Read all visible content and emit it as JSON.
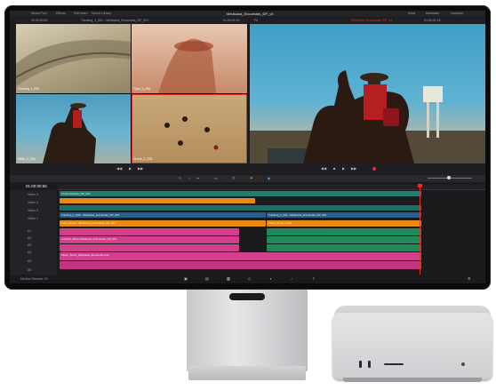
{
  "app": {
    "project_title": "Medicana_Encuestas_DP_v4",
    "top_menu": [
      "Media Pool",
      "Effects",
      "Edit Index",
      "Sound Library"
    ],
    "top_right_menu": [
      "Mixer",
      "Metadata",
      "Inspector"
    ],
    "viewer_left_header": "Tracking_1_001 - Medicana_Encuestas_DP_001",
    "viewer_left_timecode": "00:00:00:00",
    "viewer_right_zoom": "Fit",
    "viewer_right_timecode": "01:00:01:00",
    "viewer_right_header": "Medicana_Encuestas_DP_v4",
    "viewer_right_tc_end": "01:00:01:15"
  },
  "multicam": {
    "angles": [
      {
        "label": "Tracking 1_005"
      },
      {
        "label": "Tight_1_008"
      },
      {
        "label": "Wide_1_006"
      },
      {
        "label": "Drone_1_008"
      }
    ]
  },
  "timeline": {
    "timecode": "01:00:00:58",
    "tracks": [
      {
        "name": "Video 4"
      },
      {
        "name": "Video 3"
      },
      {
        "name": "Video 2"
      },
      {
        "name": "Video 1"
      },
      {
        "name": "A1"
      },
      {
        "name": "A2"
      },
      {
        "name": "A3"
      },
      {
        "name": "A4"
      },
      {
        "name": "A5"
      },
      {
        "name": "A6"
      }
    ],
    "clip_labels": {
      "v4": "Cross Dissolve_DP_001",
      "v1a": "Tracking_1_005 - Medicana_Encuestas_DP_001",
      "v1b": "Tracking_1_001 - Medicana_Encuestas_DP_001",
      "a1a": "Foley_Horse - Medicana_Encuestas_DP_001",
      "a1b": "Foley_Horse_2.wav",
      "a3": "Ambient_Wind_Medicana_Encuestas_DP_001",
      "a5": "Music_Score_Medicana_Encuestas.wav"
    },
    "footer_status": "DaVinci Resolve 19"
  },
  "colors": {
    "accent_red": "#e0322b",
    "clip_teal": "#1f7d73",
    "clip_blue": "#2a5e8c",
    "clip_orange": "#e58a16",
    "clip_pink": "#d23f8d",
    "clip_green": "#1e8a5a"
  }
}
